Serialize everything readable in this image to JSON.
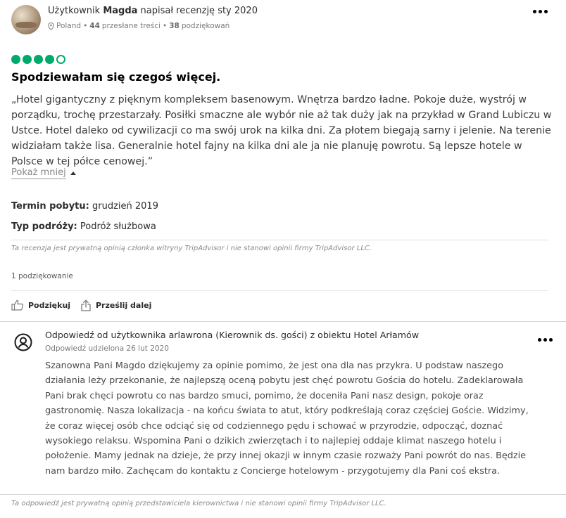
{
  "review": {
    "author_prefix": "Użytkownik",
    "author_name": "Magda",
    "author_suffix": "napisał recenzję sty 2020",
    "location": "Poland",
    "contributions_count": "44",
    "contributions_label": "przesłane treści",
    "helpful_count": "38",
    "helpful_label": "podziękowań",
    "rating": 4,
    "rating_max": 5,
    "title": "Spodziewałam się czegoś więcej.",
    "text": "„Hotel gigantyczny z pięknym kompleksem basenowym. Wnętrza bardzo ładne. Pokoje duże, wystrój w porządku, trochę przestarzały. Posiłki smaczne ale wybór nie aż tak duży jak na przykład w Grand Lubiczu w Ustce. Hotel daleko od cywilizacji co ma swój urok na kilka dni. Za płotem biegają sarny i jelenie. Na terenie widziałam także lisa. Generalnie hotel fajny na kilka dni ale ja nie planuję powrotu. Są lepsze hotele w Polsce w tej półce cenowej.”",
    "show_less": "Pokaż mniej",
    "stay_label": "Termin pobytu:",
    "stay_value": "grudzień 2019",
    "trip_label": "Typ podróży:",
    "trip_value": "Podróż służbowa",
    "disclaimer": "Ta recenzja jest prywatną opinią członka witryny TripAdvisor i nie stanowi opinii firmy TripAdvisor LLC.",
    "thanks_count": "1 podziękowanie",
    "like_label": "Podziękuj",
    "share_label": "Prześlij dalej"
  },
  "response": {
    "title": "Odpowiedź od użytkownika arlawrona (Kierownik ds. gości) z obiektu Hotel Arłamów",
    "date": "Odpowiedź udzielona 26 lut 2020",
    "text": "Szanowna Pani Magdo dziękujemy za opinie pomimo, że jest ona dla nas przykra. U podstaw naszego działania leży przekonanie, że najlepszą oceną pobytu jest chęć powrotu Gościa do hotelu. Zadeklarowała Pani brak chęci powrotu co nas bardzo smuci, pomimo, że doceniła Pani nasz design, pokoje oraz gastronomię. Nasza lokalizacja - na końcu świata to atut, który podkreślają coraz częściej Goście. Widzimy, że coraz więcej osób chce odciąć się od codziennego pędu i schować w przyrodzie, odpocząć, doznać wysokiego relaksu. Wspomina Pani o dzikich zwierzętach i to najlepiej oddaje klimat naszego hotelu i położenie. Mamy jednak na dzieje, że przy innej okazji w innym czasie rozważy Pani powrót do nas. Będzie nam bardzo miło. Zachęcam do kontaktu z Concierge hotelowym - przygotujemy dla Pani coś ekstra.",
    "disclaimer": "Ta odpowiedź jest prywatną opinią przedstawiciela kierownictwa i nie stanowi opinii firmy TripAdvisor LLC."
  },
  "icons": {
    "avatar": "user-photo",
    "location": "map-pin-icon",
    "more": "more-options-icon",
    "rating": "rating-bubble-icon",
    "like": "thumbs-up-icon",
    "share": "share-icon",
    "responder": "user-circle-icon"
  },
  "colors": {
    "rating": "#00aa6c",
    "text": "#2c2c2c",
    "muted": "#8a8a8a"
  }
}
